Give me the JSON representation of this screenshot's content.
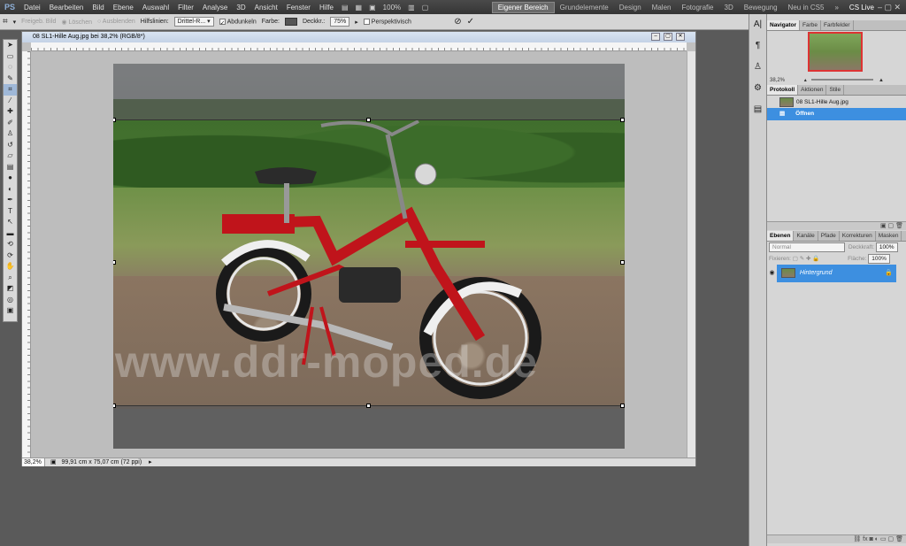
{
  "app": {
    "logo": "PS"
  },
  "menu": [
    "Datei",
    "Bearbeiten",
    "Bild",
    "Ebene",
    "Auswahl",
    "Filter",
    "Analyse",
    "3D",
    "Ansicht",
    "Fenster",
    "Hilfe"
  ],
  "appbar_zoom": "100%",
  "workspaces": [
    {
      "label": "Eigener Bereich",
      "active": true
    },
    {
      "label": "Grundelemente",
      "active": false
    },
    {
      "label": "Design",
      "active": false
    },
    {
      "label": "Malen",
      "active": false
    },
    {
      "label": "Fotografie",
      "active": false
    },
    {
      "label": "3D",
      "active": false
    },
    {
      "label": "Bewegung",
      "active": false
    },
    {
      "label": "Neu in CS5",
      "active": false
    }
  ],
  "cslive": "CS Live",
  "options": {
    "pregrid_label": "Freigeb. Bild",
    "delete_label": "Löschen",
    "hide_label": "Ausblenden",
    "guides_label": "Hilfslinien:",
    "guides_value": "Drittel-R...",
    "shield_label": "Abdunkeln",
    "color_label": "Farbe:",
    "opacity_label": "Deckkr.:",
    "opacity_value": "75%",
    "perspective_label": "Perspektivisch",
    "shield_color": "#555555"
  },
  "document": {
    "title": "08 SL1-Hille Aug.jpg bei 38,2% (RGB/8*)",
    "zoom": "38,2%",
    "doc_size": "99,91 cm x 75,07 cm (72 ppi)",
    "watermark": "www.ddr-moped.de"
  },
  "navigator": {
    "tabs": [
      "Navigator",
      "Farbe",
      "Farbfelder"
    ],
    "zoom": "38,2%"
  },
  "history": {
    "tabs": [
      "Protokoll",
      "Aktionen",
      "Stile"
    ],
    "items": [
      {
        "label": "08 SL1-Hille Aug.jpg"
      },
      {
        "label": "Öffnen"
      }
    ]
  },
  "layers": {
    "tabs": [
      "Ebenen",
      "Kanäle",
      "Pfade",
      "Korrekturen",
      "Masken"
    ],
    "blend_mode": "Normal",
    "opacity_label": "Deckkraft:",
    "opacity_value": "100%",
    "lock_label": "Fixieren:",
    "fill_label": "Fläche:",
    "fill_value": "100%",
    "items": [
      {
        "label": "Hintergrund"
      }
    ]
  },
  "accent_color": "#3d8fe0"
}
